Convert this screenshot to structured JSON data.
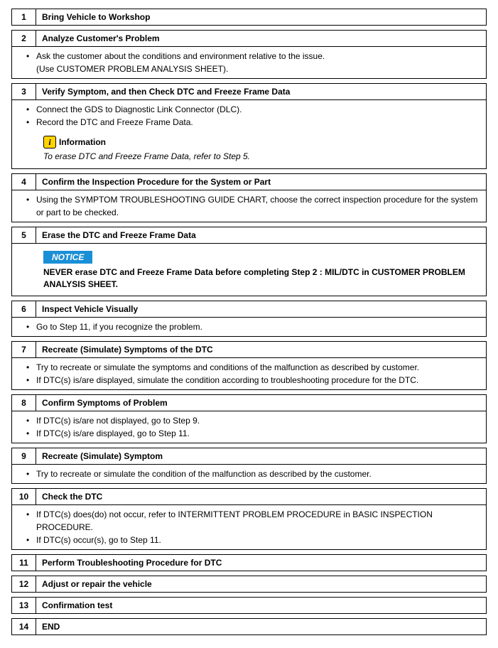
{
  "steps": [
    {
      "num": "1",
      "title": "Bring Vehicle to Workshop"
    },
    {
      "num": "2",
      "title": "Analyze Customer's Problem",
      "bullets": [
        "Ask the customer about the conditions and environment relative to the issue."
      ],
      "extra": "(Use CUSTOMER PROBLEM ANALYSIS SHEET)."
    },
    {
      "num": "3",
      "title": "Verify Symptom, and then Check DTC and Freeze Frame Data",
      "bullets": [
        "Connect the GDS to Diagnostic Link Connector (DLC).",
        "Record the DTC and Freeze Frame Data."
      ],
      "info": {
        "label": "Information",
        "text": "To erase DTC and Freeze Frame Data, refer to Step 5."
      }
    },
    {
      "num": "4",
      "title": "Confirm the Inspection Procedure for the System or Part",
      "bullets": [
        "Using the SYMPTOM TROUBLESHOOTING GUIDE CHART, choose the correct inspection procedure for the system or part to be checked."
      ]
    },
    {
      "num": "5",
      "title": "Erase the DTC and Freeze Frame Data",
      "notice": {
        "badge": "NOTICE",
        "text": "NEVER erase DTC and Freeze Frame Data before completing Step 2 : MIL/DTC in CUSTOMER PROBLEM ANALYSIS SHEET."
      }
    },
    {
      "num": "6",
      "title": "Inspect Vehicle Visually",
      "bullets": [
        "Go to Step 11, if you recognize the problem."
      ]
    },
    {
      "num": "7",
      "title": "Recreate (Simulate) Symptoms of the DTC",
      "bullets": [
        "Try to recreate or simulate the symptoms and conditions of the malfunction as described by customer.",
        "If DTC(s) is/are displayed, simulate the condition according to troubleshooting procedure for the DTC."
      ]
    },
    {
      "num": "8",
      "title": "Confirm Symptoms of Problem",
      "bullets": [
        "If DTC(s) is/are not displayed, go to Step 9.",
        "If DTC(s) is/are displayed, go to Step 11."
      ]
    },
    {
      "num": "9",
      "title": "Recreate (Simulate) Symptom",
      "bullets": [
        "Try to recreate or simulate the condition of the malfunction as described by the customer."
      ]
    },
    {
      "num": "10",
      "title": "Check the DTC",
      "bullets": [
        "If DTC(s) does(do) not occur, refer to INTERMITTENT PROBLEM PROCEDURE in BASIC INSPECTION PROCEDURE.",
        "If DTC(s) occur(s), go to Step 11."
      ]
    },
    {
      "num": "11",
      "title": "Perform Troubleshooting Procedure for DTC"
    },
    {
      "num": "12",
      "title": "Adjust or repair the vehicle"
    },
    {
      "num": "13",
      "title": "Confirmation test"
    },
    {
      "num": "14",
      "title": "END"
    }
  ],
  "info_icon_glyph": "i"
}
